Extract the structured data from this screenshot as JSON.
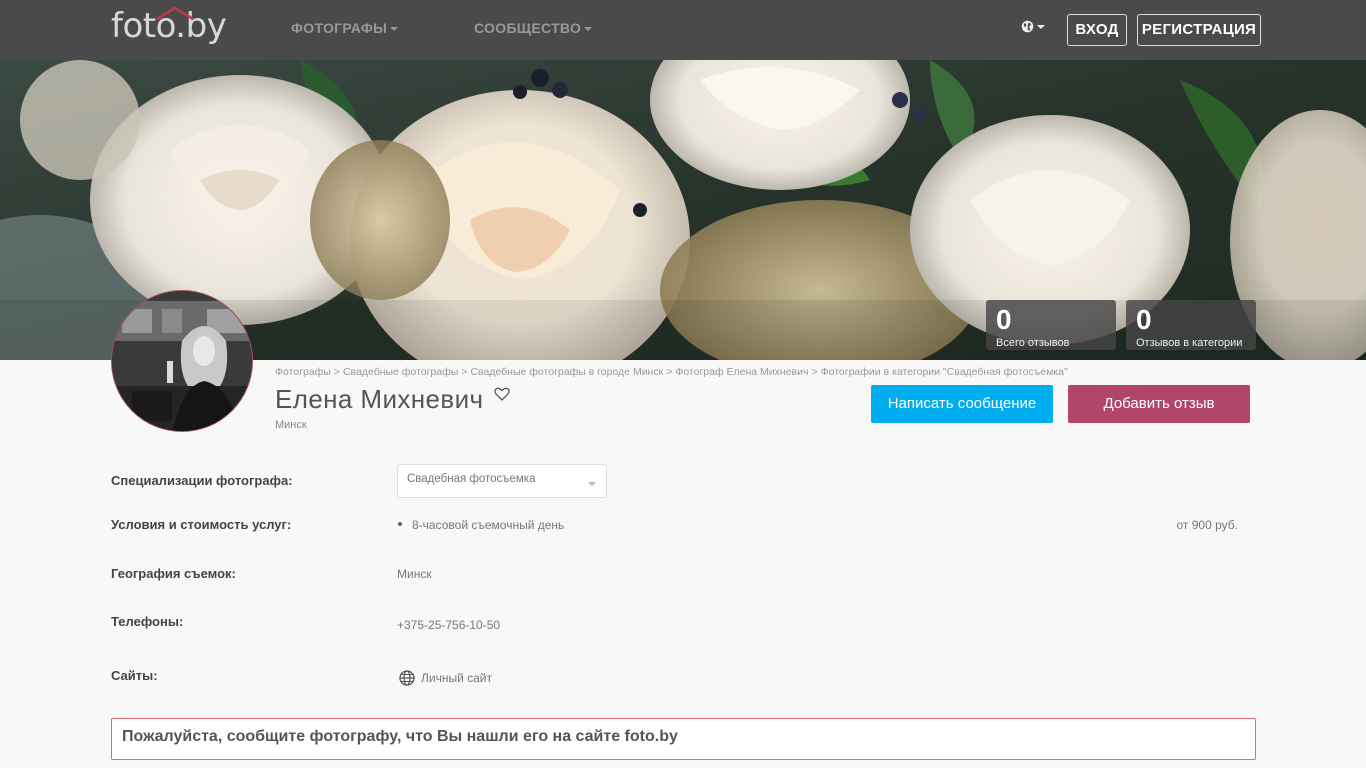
{
  "logo": {
    "text": "foto.by"
  },
  "nav": {
    "menu": [
      {
        "label": "ФОТОГРАФЫ"
      },
      {
        "label": "СООБЩЕСТВО"
      }
    ],
    "login": "ВХОД",
    "register": "РЕГИСТРАЦИЯ"
  },
  "stats": [
    {
      "value": "0",
      "label": "Всего отзывов"
    },
    {
      "value": "0",
      "label": "Отзывов в категории"
    }
  ],
  "breadcrumb": [
    "Фотографы",
    "Свадебные фотографы",
    "Свадебные фотографы в городе Минск",
    "Фотограф Елена Михневич",
    "Фотографии в категории \"Свадебная фотосъемка\""
  ],
  "breadcrumb_separator": ">",
  "profile": {
    "name": "Елена Михневич",
    "city": "Минск",
    "message_button": "Написать сообщение",
    "review_button": "Добавить отзыв"
  },
  "details": {
    "specializations_label": "Специализации фотографа:",
    "specialization_selected": "Свадебная фотосъемка",
    "services_label": "Условия и стоимость услуг:",
    "service_item": "8-часовой съемочный день",
    "service_price": "от 900 руб.",
    "geography_label": "География съемок:",
    "geography_value": "Минск",
    "phones_label": "Телефоны:",
    "phone_value": "+375-25-756-10-50",
    "sites_label": "Сайты:",
    "site_link": "Личный сайт"
  },
  "notice": "Пожалуйста, сообщите фотографу, что Вы нашли его на сайте foto.by",
  "colors": {
    "navbar": "#4a4a4a",
    "message_button": "#00aeef",
    "review_button": "#b2466a",
    "notice_border": "#e06a7a"
  }
}
